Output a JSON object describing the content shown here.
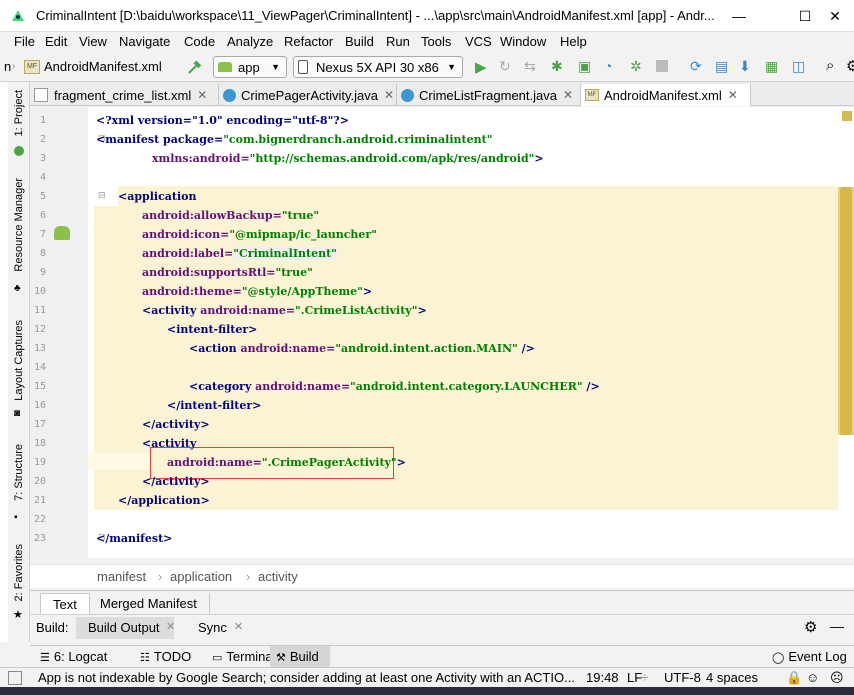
{
  "window": {
    "title": "CriminalIntent [D:\\baidu\\workspace\\11_ViewPager\\CriminalIntent] - ...\\app\\src\\main\\AndroidManifest.xml [app] - Andr...",
    "controls": [
      "—",
      "☐",
      "✕"
    ]
  },
  "menu": [
    "File",
    "Edit",
    "View",
    "Navigate",
    "Code",
    "Analyze",
    "Refactor",
    "Build",
    "Run",
    "Tools",
    "VCS",
    "Window",
    "Help"
  ],
  "toolbar": {
    "breadcrumb_prefix": "n",
    "file": "AndroidManifest.xml",
    "module": "app",
    "device": "Nexus 5X API 30 x86"
  },
  "side_tools": [
    "1: Project",
    "Resource Manager",
    "Layout Captures",
    "7: Structure",
    "2: Favorites"
  ],
  "tabs": [
    {
      "label": "fragment_crime_list.xml",
      "type": "xml",
      "active": false
    },
    {
      "label": "CrimePagerActivity.java",
      "type": "java",
      "active": false
    },
    {
      "label": "CrimeListFragment.java",
      "type": "java",
      "active": false
    },
    {
      "label": "AndroidManifest.xml",
      "type": "manifest",
      "active": true
    }
  ],
  "editor": {
    "line_numbers": [
      "1",
      "2",
      "3",
      "4",
      "5",
      "6",
      "7",
      "8",
      "9",
      "10",
      "11",
      "12",
      "13",
      "14",
      "15",
      "16",
      "17",
      "18",
      "19",
      "20",
      "21",
      "22",
      "23"
    ],
    "lines": {
      "l1_pi": "<?xml version=\"1.0\" encoding=\"utf-8\"?>",
      "l2_tag": "<manifest ",
      "l2_attr": "package=",
      "l2_val": "\"com.bignerdranch.android.criminalintent\"",
      "l3_attr": "xmlns:android=",
      "l3_val": "\"http://schemas.android.com/apk/res/android\"",
      "l3_end": ">",
      "l5": "<application",
      "l6_attr": "android:allowBackup=",
      "l6_val": "\"true\"",
      "l7_attr": "android:icon=",
      "l7_val": "\"@mipmap/ic_launcher\"",
      "l8_attr": "android:label=",
      "l8_val": "\"CriminalIntent\"",
      "l9_attr": "android:supportsRtl=",
      "l9_val": "\"true\"",
      "l10_attr": "android:theme=",
      "l10_val": "\"@style/AppTheme\"",
      "l10_end": ">",
      "l11_tag": "<activity ",
      "l11_attr": "android:name=",
      "l11_val": "\".CrimeListActivity\"",
      "l11_end": ">",
      "l12": "<intent-filter>",
      "l13_tag": "<action ",
      "l13_attr": "android:name=",
      "l13_val": "\"android.intent.action.MAIN\"",
      "l13_end": " />",
      "l15_tag": "<category ",
      "l15_attr": "android:name=",
      "l15_val": "\"android.intent.category.LAUNCHER\"",
      "l15_end": " />",
      "l16": "</intent-filter>",
      "l17": "</activity>",
      "l18": "<activity",
      "l19_attr": "android:name=",
      "l19_val": "\".CrimePagerActivity\"",
      "l19_end": ">",
      "l20": "</activity>",
      "l21": "</application>",
      "l23": "</manifest>"
    }
  },
  "breadcrumb": [
    "manifest",
    "application",
    "activity"
  ],
  "editor_mode_tabs": [
    "Text",
    "Merged Manifest"
  ],
  "build_bar": {
    "label": "Build:",
    "tabs": [
      "Build Output",
      "Sync"
    ]
  },
  "tool_windows": [
    "6: Logcat",
    "TODO",
    "Terminal",
    "Build",
    "Event Log"
  ],
  "status": {
    "message": "App is not indexable by Google Search; consider adding at least one Activity with an ACTIO...",
    "position": "19:48",
    "line_sep": "LF",
    "encoding": "UTF-8",
    "indent": "4 spaces"
  },
  "colors": {
    "highlight": "#faf4d4",
    "caret_line": "#fffae3",
    "selection_box": "#e0413c",
    "tag": "#000080",
    "attr": "#660e7a",
    "value": "#008000",
    "run_green": "#4aa546",
    "android_green": "#8ac249"
  }
}
